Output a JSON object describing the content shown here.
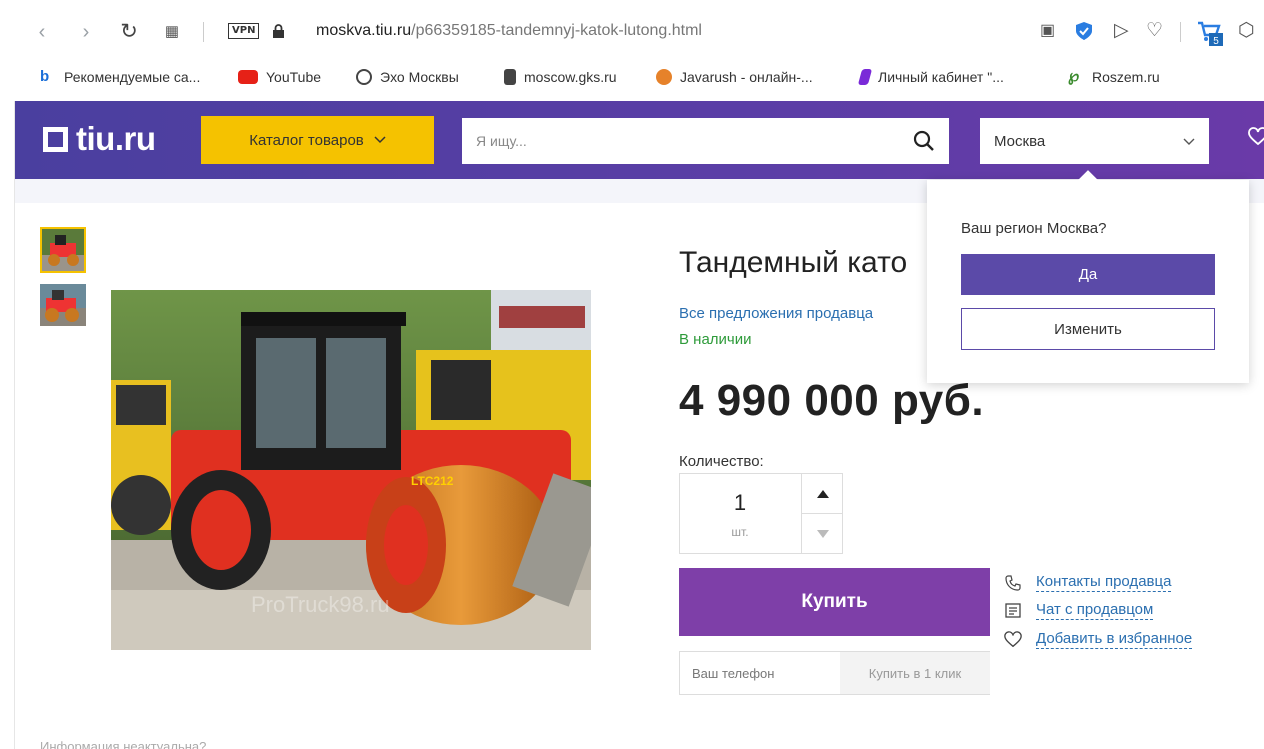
{
  "browser": {
    "url_domain": "moskva.tiu.ru",
    "url_path": "/p66359185-tandemnyj-katok-lutong.html",
    "vpn_label": "VPN",
    "cart_badge": "5",
    "icons": [
      "back-icon",
      "forward-icon",
      "reload-icon",
      "apps-icon",
      "lock-icon",
      "camera-icon",
      "shield-icon",
      "send-icon",
      "heart-icon",
      "cart-icon",
      "box-icon"
    ]
  },
  "bookmarks": [
    {
      "label": "Рекомендуемые са...",
      "color": "#1b6fd8"
    },
    {
      "label": "YouTube",
      "color": "#e62117"
    },
    {
      "label": "Эхо Москвы",
      "color": "#444444"
    },
    {
      "label": "moscow.gks.ru",
      "color": "#333333"
    },
    {
      "label": "Javarush - онлайн-...",
      "color": "#e6822a"
    },
    {
      "label": "Личный кабинет \"...",
      "color": "#7a2ad8"
    },
    {
      "label": "Roszem.ru",
      "color": "#3b8b2e"
    }
  ],
  "header": {
    "logo": "tiu.ru",
    "catalog_label": "Каталог товаров",
    "search_placeholder": "Я ищу...",
    "region": "Москва"
  },
  "product": {
    "title": "Тандемный като",
    "seller_link": "Все предложения продавца",
    "stock": "В наличии",
    "price": "4 990 000 руб.",
    "qty_label": "Количество:",
    "qty_value": "1",
    "qty_unit": "шт.",
    "buy_label": "Купить",
    "phone_placeholder": "Ваш телефон",
    "one_click_label": "Купить в 1 клик",
    "image_watermark": "ProTruck98.ru"
  },
  "side_links": [
    {
      "label": "Контакты продавца",
      "icon": "phone-icon"
    },
    {
      "label": "Чат с продавцом",
      "icon": "chat-icon"
    },
    {
      "label": "Добавить в избранное",
      "icon": "heart-icon"
    }
  ],
  "region_popup": {
    "question": "Ваш регион Москва?",
    "yes_label": "Да",
    "change_label": "Изменить"
  },
  "footer": {
    "info_text": "Информация неактуальна?"
  },
  "colors": {
    "header_purple": "#4a3f9f",
    "catalog_yellow": "#f5c200",
    "buy_purple": "#7e3fa8",
    "link_blue": "#2b6fb0",
    "stock_green": "#2e9b3a"
  }
}
